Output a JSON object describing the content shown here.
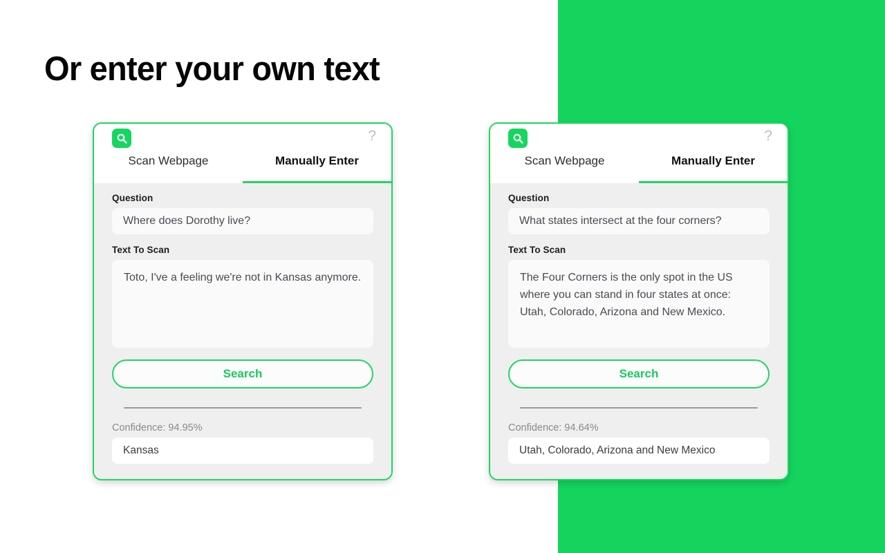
{
  "page": {
    "title": "Or enter your own text",
    "background_color": "#ffffff",
    "accent_color": "#14d45e"
  },
  "cards": [
    {
      "id": "left",
      "brand_icon": "magnifier-icon",
      "help_icon": "?",
      "tabs": [
        {
          "label": "Scan Webpage",
          "active": false
        },
        {
          "label": "Manually Enter",
          "active": true
        }
      ],
      "question_label": "Question",
      "question_value": "Where does Dorothy live?",
      "text_label": "Text To Scan",
      "text_value": "Toto, I've a feeling we're not in Kansas anymore.",
      "search_label": "Search",
      "confidence_label": "Confidence: 94.95%",
      "answer_value": "Kansas"
    },
    {
      "id": "right",
      "brand_icon": "magnifier-icon",
      "help_icon": "?",
      "tabs": [
        {
          "label": "Scan Webpage",
          "active": false
        },
        {
          "label": "Manually Enter",
          "active": true
        }
      ],
      "question_label": "Question",
      "question_value": "What states intersect at the four corners?",
      "text_label": "Text To Scan",
      "text_value": "The Four Corners is the only spot in the US where you can stand in four states at once: Utah, Colorado, Arizona and New Mexico.",
      "search_label": "Search",
      "confidence_label": "Confidence: 94.64%",
      "answer_value": "Utah, Colorado, Arizona and New Mexico"
    }
  ]
}
